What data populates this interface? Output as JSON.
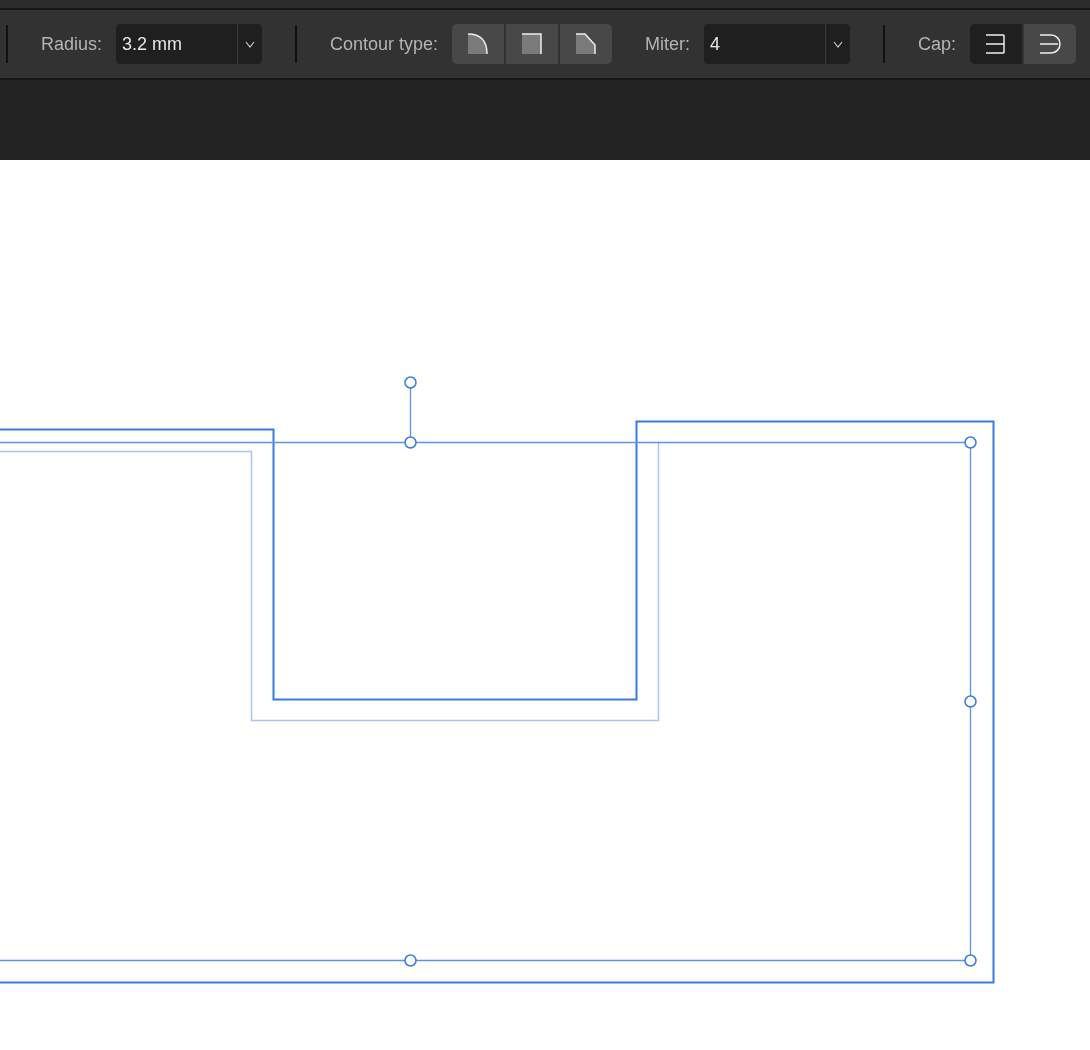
{
  "toolbar": {
    "radius": {
      "label": "Radius:",
      "value": "3.2 mm"
    },
    "contour_type": {
      "label": "Contour type:",
      "options": [
        {
          "kind": "round",
          "selected": false
        },
        {
          "kind": "miter",
          "selected": false
        },
        {
          "kind": "bevel",
          "selected": false
        }
      ]
    },
    "miter": {
      "label": "Miter:",
      "value": "4"
    },
    "cap": {
      "label": "Cap:",
      "options": [
        {
          "kind": "butt",
          "selected": true
        },
        {
          "kind": "round",
          "selected": false
        }
      ]
    }
  }
}
